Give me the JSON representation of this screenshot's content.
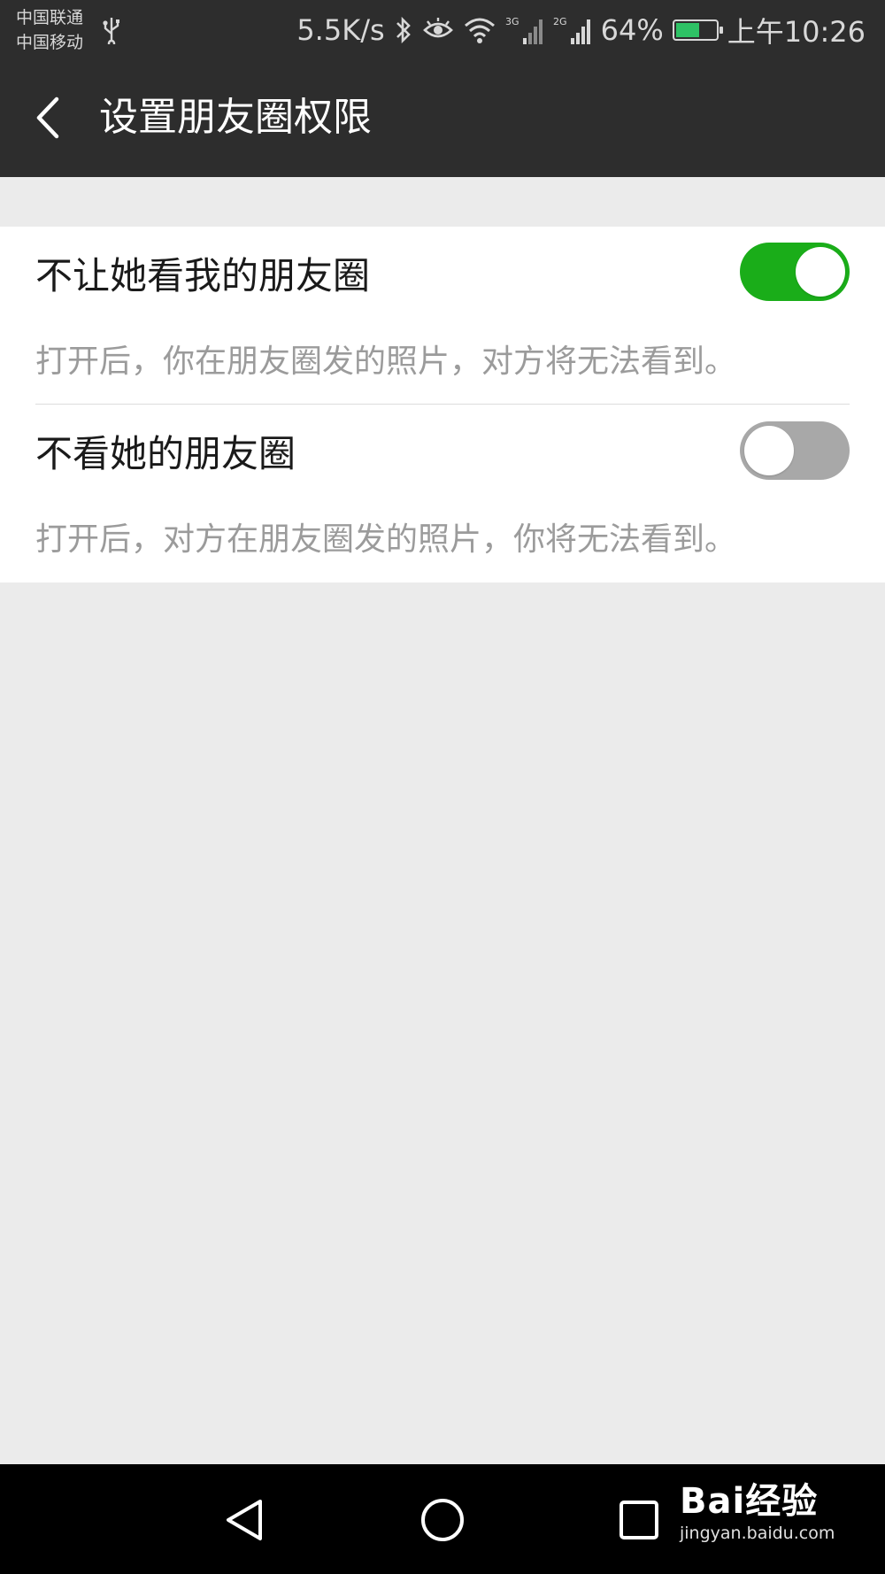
{
  "status_bar": {
    "carrier_1": "中国联通",
    "carrier_2": "中国移动",
    "net_speed": "5.5K/s",
    "signal_1_tag": "3G",
    "signal_2_tag": "2G",
    "battery_percent": "64%",
    "battery_level": 0.64,
    "time": "上午10:26"
  },
  "header": {
    "title": "设置朋友圈权限",
    "back_icon": "chevron-left-icon"
  },
  "settings": [
    {
      "title": "不让她看我的朋友圈",
      "description": "打开后，你在朋友圈发的照片，对方将无法看到。",
      "enabled": true
    },
    {
      "title": "不看她的朋友圈",
      "description": "打开后，对方在朋友圈发的照片，你将无法看到。",
      "enabled": false
    }
  ],
  "nav_bar": {
    "icons": [
      "back-triangle-icon",
      "home-circle-icon",
      "recents-square-icon"
    ]
  },
  "watermark": {
    "brand": "Bai经验",
    "url": "jingyan.baidu.com"
  },
  "colors": {
    "toggle_on": "#1aad19",
    "toggle_off": "#a8a8a8",
    "bar_background": "#2d2d2d",
    "page_background": "#ebebeb"
  }
}
